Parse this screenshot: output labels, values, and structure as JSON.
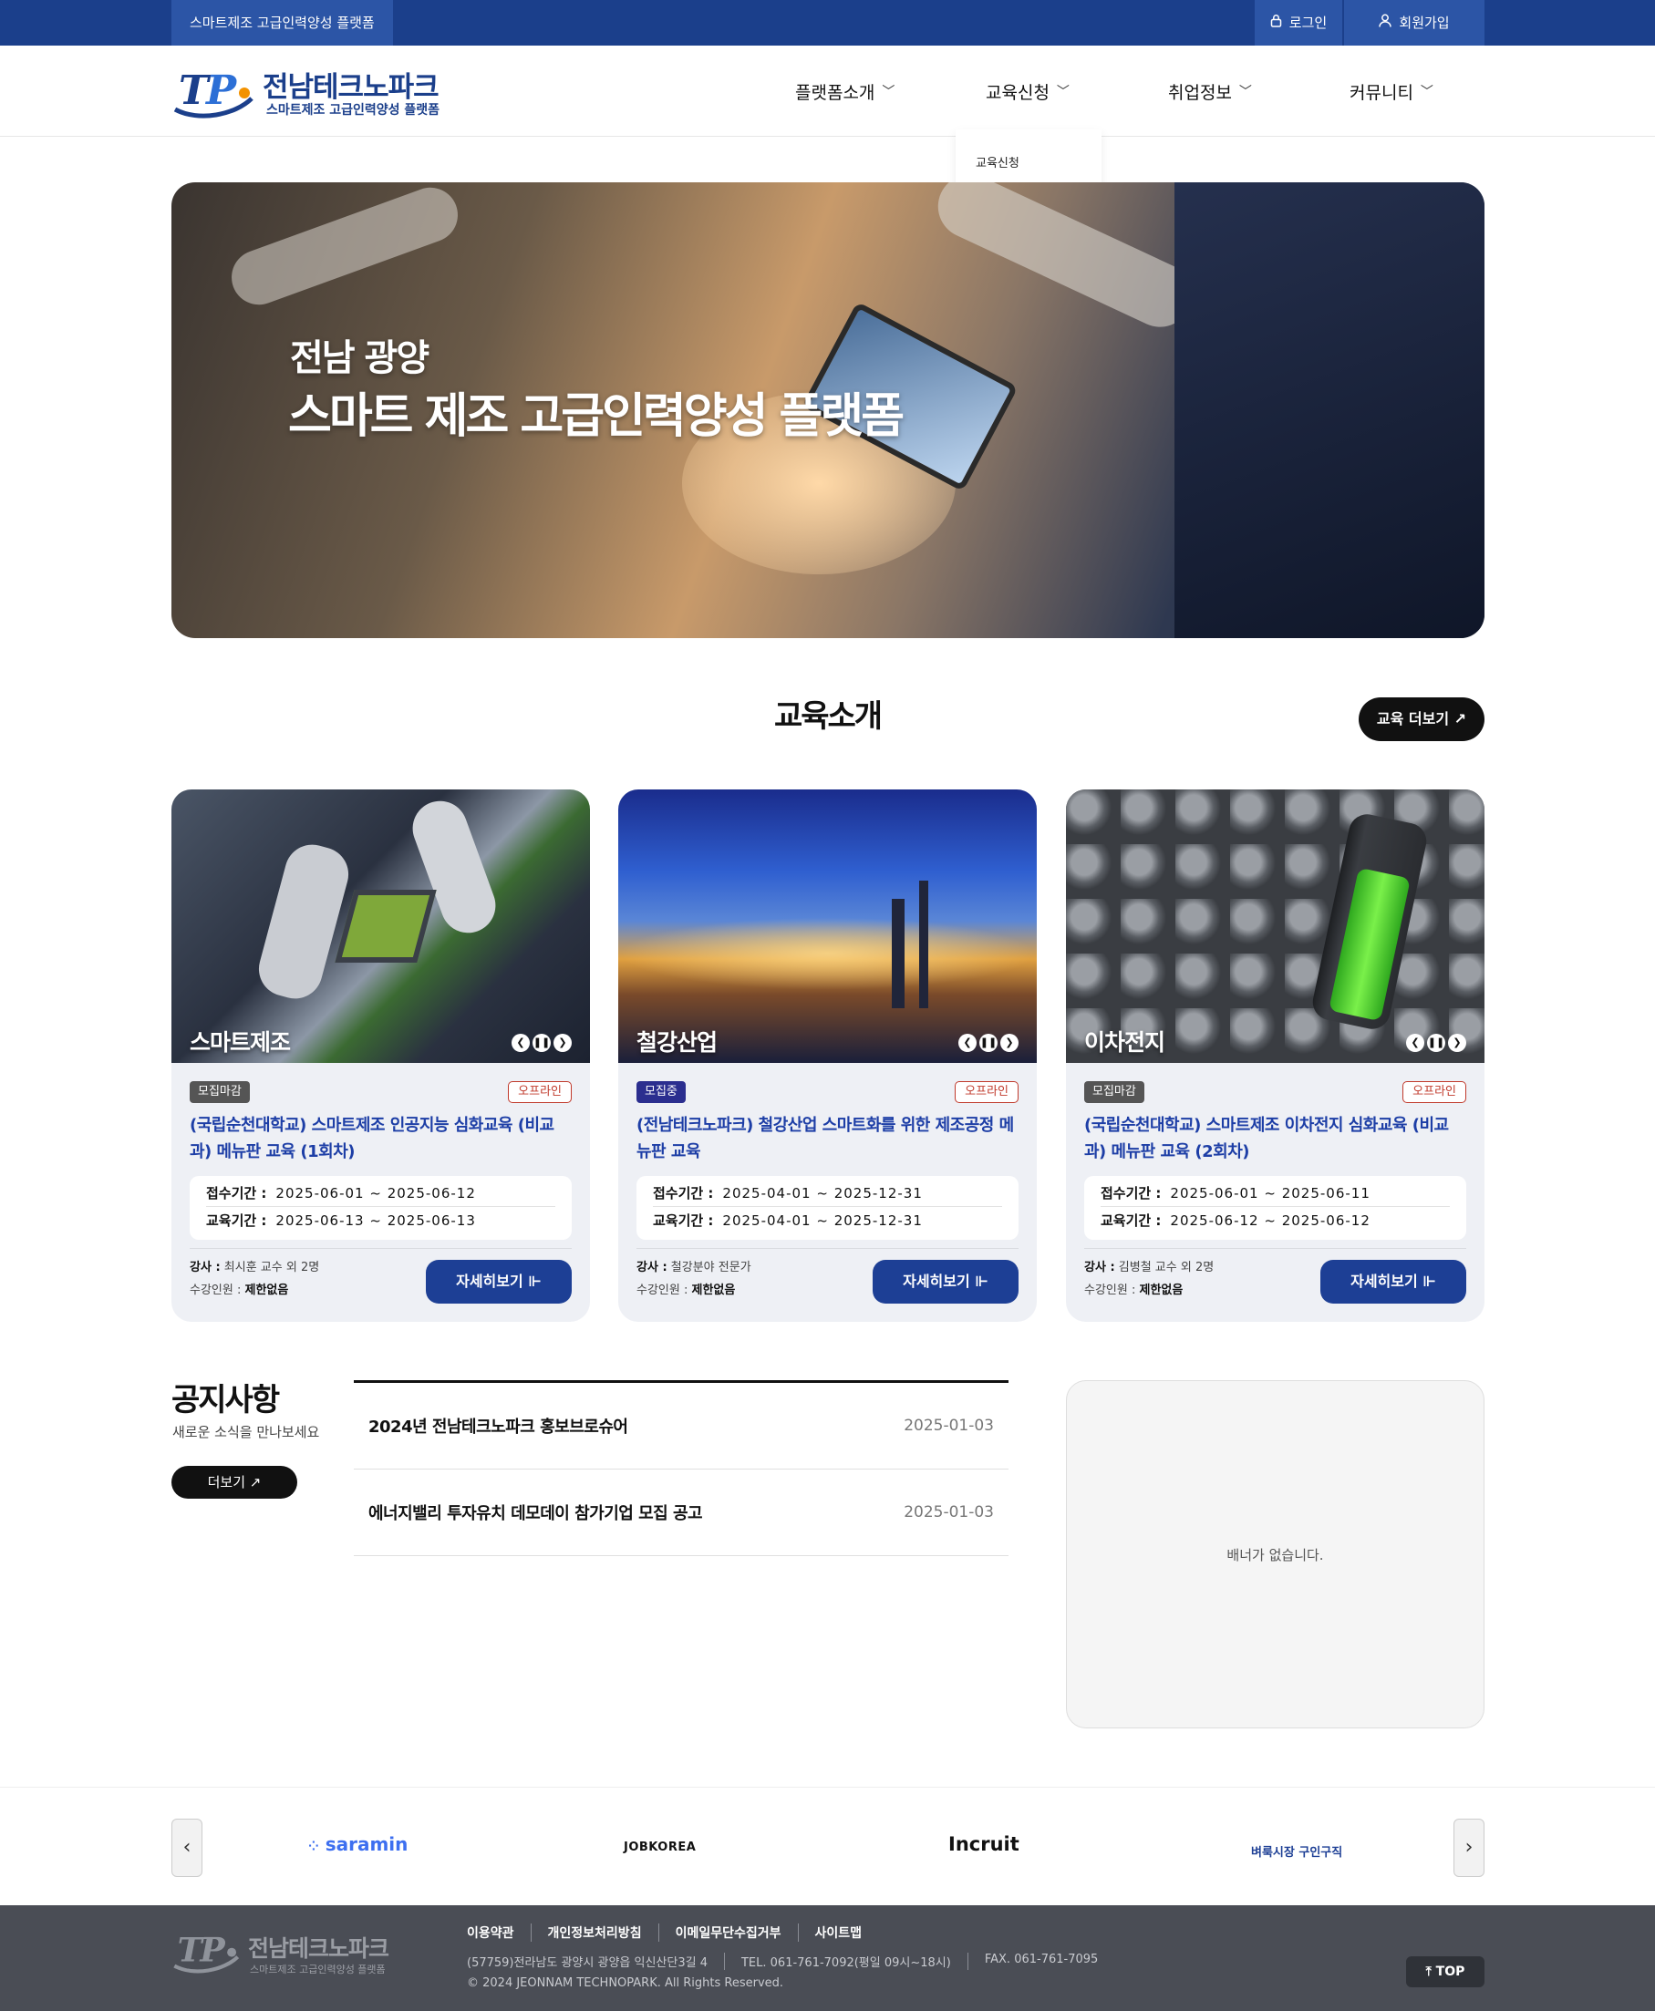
{
  "topbar": {
    "tagline": "스마트제조 고급인력양성 플랫폼",
    "login": "로그인",
    "signup": "회원가입"
  },
  "brand": {
    "name": "전남테크노파크",
    "subtitle": "스마트제조 고급인력양성 플랫폼",
    "mark": "TP."
  },
  "nav": {
    "items": [
      "플랫폼소개",
      "교육신청",
      "취업정보",
      "커뮤니티"
    ],
    "dropdown_item": "교육신청"
  },
  "hero": {
    "line1": "전남 광양",
    "line2": "스마트 제조 고급인력양성 플랫폼"
  },
  "courses": {
    "title": "교육소개",
    "more": "교육 더보기 ↗",
    "cards": [
      {
        "category": "스마트제조",
        "status": "모집마감",
        "status_color": "#555555",
        "type": "오프라인",
        "title": "(국립순천대학교) 스마트제조 인공지능 심화교육 (비교과) 메뉴판 교육 (1회차)",
        "reg_label": "접수기간 :",
        "reg_period": "2025-06-01 ~ 2025-06-12",
        "edu_label": "교육기간 :",
        "edu_period": "2025-06-13 ~ 2025-06-13",
        "instructor_label": "강사 :",
        "instructor": "최시훈 교수 외 2명",
        "capacity_label": "수강인원 :",
        "capacity": "제한없음",
        "button": "자세히보기 ⊩"
      },
      {
        "category": "철강산업",
        "status": "모집중",
        "status_color": "#2b2e8f",
        "type": "오프라인",
        "title": "(전남테크노파크) 철강산업 스마트화를 위한 제조공정 메뉴판 교육",
        "reg_label": "접수기간 :",
        "reg_period": "2025-04-01 ~ 2025-12-31",
        "edu_label": "교육기간 :",
        "edu_period": "2025-04-01 ~ 2025-12-31",
        "instructor_label": "강사 :",
        "instructor": "철강분야 전문가",
        "capacity_label": "수강인원 :",
        "capacity": "제한없음",
        "button": "자세히보기 ⊩"
      },
      {
        "category": "이차전지",
        "status": "모집마감",
        "status_color": "#555555",
        "type": "오프라인",
        "title": "(국립순천대학교) 스마트제조 이차전지 심화교육 (비교과) 메뉴판 교육 (2회차)",
        "reg_label": "접수기간 :",
        "reg_period": "2025-06-01 ~ 2025-06-11",
        "edu_label": "교육기간 :",
        "edu_period": "2025-06-12 ~ 2025-06-12",
        "instructor_label": "강사 :",
        "instructor": "김병철 교수 외 2명",
        "capacity_label": "수강인원 :",
        "capacity": "제한없음",
        "button": "자세히보기 ⊩"
      }
    ]
  },
  "notice": {
    "title": "공지사항",
    "subtitle": "새로운 소식을 만나보세요",
    "more": "더보기 ↗",
    "items": [
      {
        "title": "2024년 전남테크노파크 홍보브로슈어",
        "date": "2025-01-03"
      },
      {
        "title": "에너지밸리 투자유치 데모데이 참가기업 모집 공고",
        "date": "2025-01-03"
      }
    ]
  },
  "banner": {
    "empty_text": "배너가 없습니다."
  },
  "partners": {
    "logos": [
      "saramin",
      "JOBKOREA",
      "Incruit",
      "벼룩시장 구인구직"
    ],
    "prev": "‹",
    "next": "›"
  },
  "footer": {
    "brand": "전남테크노파크",
    "brand_sub": "스마트제조 고급인력양성 플랫폼",
    "links": [
      "이용약관",
      "개인정보처리방침",
      "이메일무단수집거부",
      "사이트맵"
    ],
    "address": "(57759)전라남도 광양시 광양읍 익신산단3길 4",
    "tel": "TEL. 061-761-7092(평일 09시~18시)",
    "fax": "FAX. 061-761-7095",
    "copyright": "© 2024 JEONNAM TECHNOPARK. All Rights Reserved.",
    "top": "TOP"
  }
}
